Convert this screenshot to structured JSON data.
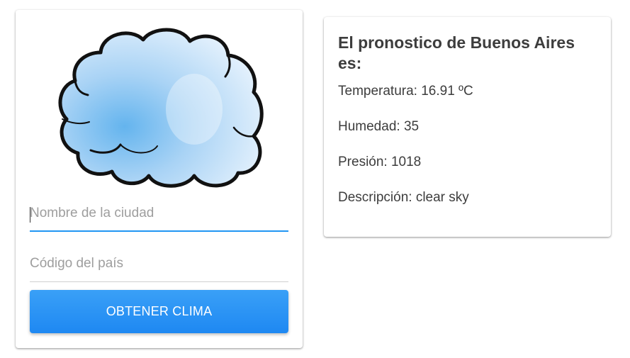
{
  "form": {
    "city_placeholder": "Nombre de la ciudad",
    "country_placeholder": "Código del país",
    "submit_label": "OBTENER CLIMA"
  },
  "result": {
    "title": "El pronostico de Buenos Aires es:",
    "temperature": "Temperatura: 16.91 ºC",
    "humidity": "Humedad: 35",
    "pressure": "Presión: 1018",
    "description": "Descripción: clear sky"
  },
  "icons": {
    "cloud": "cloud-icon"
  },
  "colors": {
    "accent": "#2196f3",
    "button_top": "#3aa0f7",
    "button_bottom": "#1e88f2",
    "cloud_fill": "#bcdcf6"
  }
}
